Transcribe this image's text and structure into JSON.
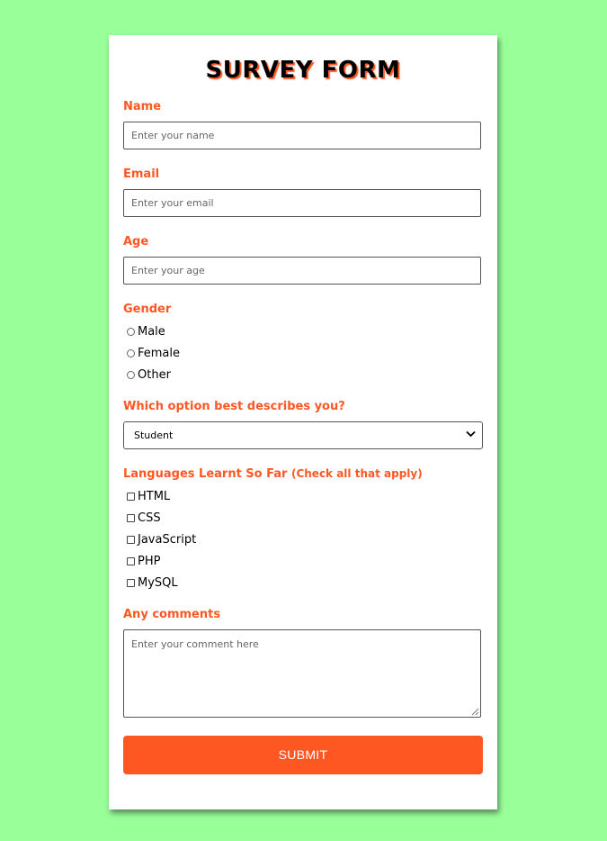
{
  "form": {
    "title": "SURVEY FORM",
    "name": {
      "label": "Name",
      "placeholder": "Enter your name"
    },
    "email": {
      "label": "Email",
      "placeholder": "Enter your email"
    },
    "age": {
      "label": "Age",
      "placeholder": "Enter your age"
    },
    "gender": {
      "label": "Gender",
      "options": [
        "Male",
        "Female",
        "Other"
      ]
    },
    "role": {
      "label": "Which option best describes you?",
      "selected": "Student"
    },
    "languages": {
      "label": "Languages Learnt So Far",
      "hint": "(Check all that apply)",
      "options": [
        "HTML",
        "CSS",
        "JavaScript",
        "PHP",
        "MySQL"
      ]
    },
    "comments": {
      "label": "Any comments",
      "placeholder": "Enter your comment here"
    },
    "submit_label": "SUBMIT"
  },
  "colors": {
    "background": "#99ff99",
    "accent": "#ff5722",
    "card": "#ffffff"
  }
}
